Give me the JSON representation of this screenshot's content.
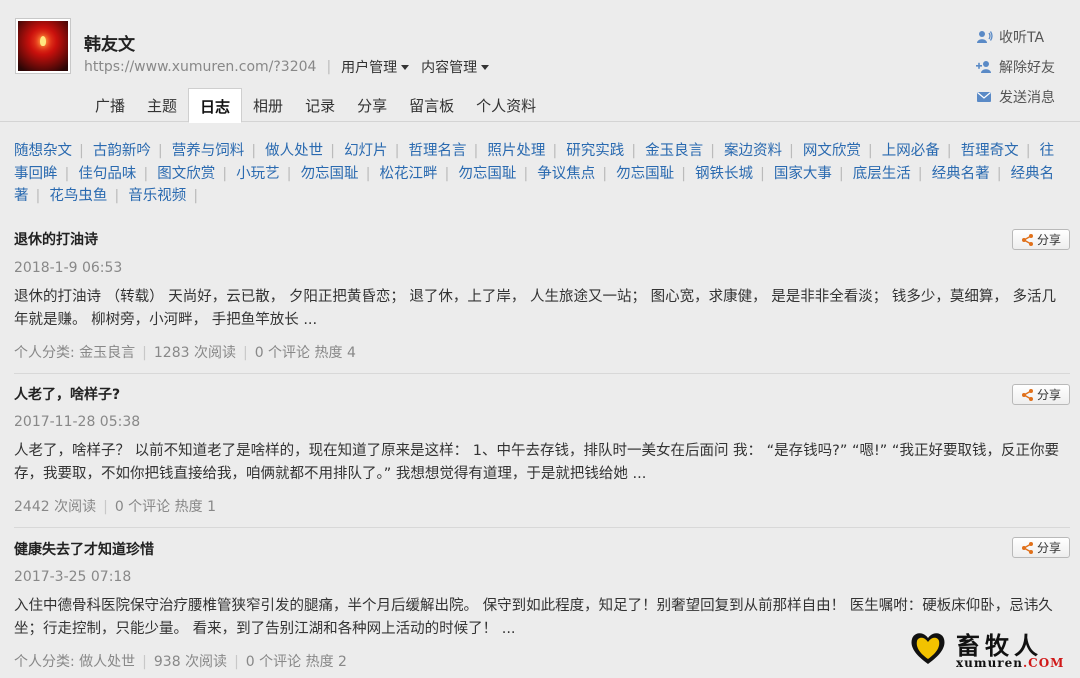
{
  "profile": {
    "name": "韩友文",
    "url": "https://www.xumuren.com/?3204",
    "menus": [
      "用户管理",
      "内容管理"
    ]
  },
  "tabs": [
    "广播",
    "主题",
    "日志",
    "相册",
    "记录",
    "分享",
    "留言板",
    "个人资料"
  ],
  "active_tab": "日志",
  "actions": [
    {
      "label": "收听TA",
      "icon": "listen-icon"
    },
    {
      "label": "解除好友",
      "icon": "remove-friend-icon"
    },
    {
      "label": "发送消息",
      "icon": "message-icon"
    }
  ],
  "categories": [
    "随想杂文",
    "古韵新吟",
    "营养与饲料",
    "做人处世",
    "幻灯片",
    "哲理名言",
    "照片处理",
    "研究实践",
    "金玉良言",
    "案边资料",
    "网文欣赏",
    "上网必备",
    "哲理奇文",
    "往事回眸",
    "佳句品味",
    "图文欣赏",
    "小玩艺",
    "勿忘国耻",
    "松花江畔",
    "勿忘国耻",
    "争议焦点",
    "勿忘国耻",
    "钢铁长城",
    "国家大事",
    "底层生活",
    "经典名著",
    "经典名著",
    "花鸟虫鱼",
    "音乐视频"
  ],
  "share_label": "分享",
  "posts": [
    {
      "title": "退休的打油诗",
      "date": "2018-1-9 06:53",
      "body": "退休的打油诗 （转载） 天尚好，云已散， 夕阳正把黄昏恋； 退了休，上了岸， 人生旅途又一站； 图心宽，求康健， 是是非非全看淡； 钱多少，莫细算， 多活几年就是赚。 柳树旁，小河畔， 手把鱼竿放长 ...",
      "category": "个人分类: 金玉良言",
      "reads": "1283 次阅读",
      "comments": "0 个评论",
      "heat": "热度 4"
    },
    {
      "title": "人老了，啥样子?",
      "date": "2017-11-28 05:38",
      "body": "人老了，啥样子？ 以前不知道老了是啥样的，现在知道了原来是这样： 1、中午去存钱，排队时一美女在后面问 我： “是存钱吗?” “嗯!” “我正好要取钱，反正你要存，我要取，不如你把钱直接给我，咱俩就都不用排队了。” 我想想觉得有道理，于是就把钱给她 ...",
      "category": "",
      "reads": "2442 次阅读",
      "comments": "0 个评论",
      "heat": "热度 1"
    },
    {
      "title": "健康失去了才知道珍惜",
      "date": "2017-3-25 07:18",
      "body": "入住中德骨科医院保守治疗腰椎管狭窄引发的腿痛，半个月后缓解出院。 保守到如此程度，知足了！别奢望回复到从前那样自由！ 医生嘱咐：硬板床仰卧，忌讳久坐；行走控制，只能少量。 看来，到了告别江湖和各种网上活动的时候了！ ...",
      "category": "个人分类: 做人处世",
      "reads": "938 次阅读",
      "comments": "0 个评论",
      "heat": "热度 2"
    }
  ],
  "watermark": {
    "text": "畜牧人",
    "sub": "xumuren",
    "sub_suffix": ".COM"
  },
  "colors": {
    "link": "#2a6ab0",
    "background": "#ececec",
    "watermark_red": "#d01818"
  }
}
